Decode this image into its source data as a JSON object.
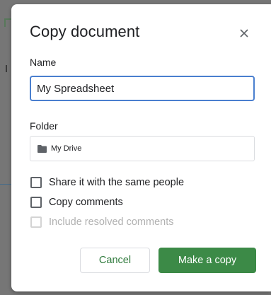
{
  "dialog": {
    "title": "Copy document",
    "close_icon": "close-icon"
  },
  "name_field": {
    "label": "Name",
    "value": "My Spreadsheet"
  },
  "folder_field": {
    "label": "Folder",
    "icon": "folder-icon",
    "value": "My Drive"
  },
  "options": {
    "share_label": "Share it with the same people",
    "share_checked": false,
    "comments_label": "Copy comments",
    "comments_checked": false,
    "resolved_label": "Include resolved comments",
    "resolved_checked": false,
    "resolved_disabled": true
  },
  "actions": {
    "cancel_label": "Cancel",
    "copy_label": "Make a copy"
  },
  "colors": {
    "primary_green": "#3c8a47",
    "focus_blue": "#4a7fcf",
    "disabled_text": "#b1b1b1"
  }
}
